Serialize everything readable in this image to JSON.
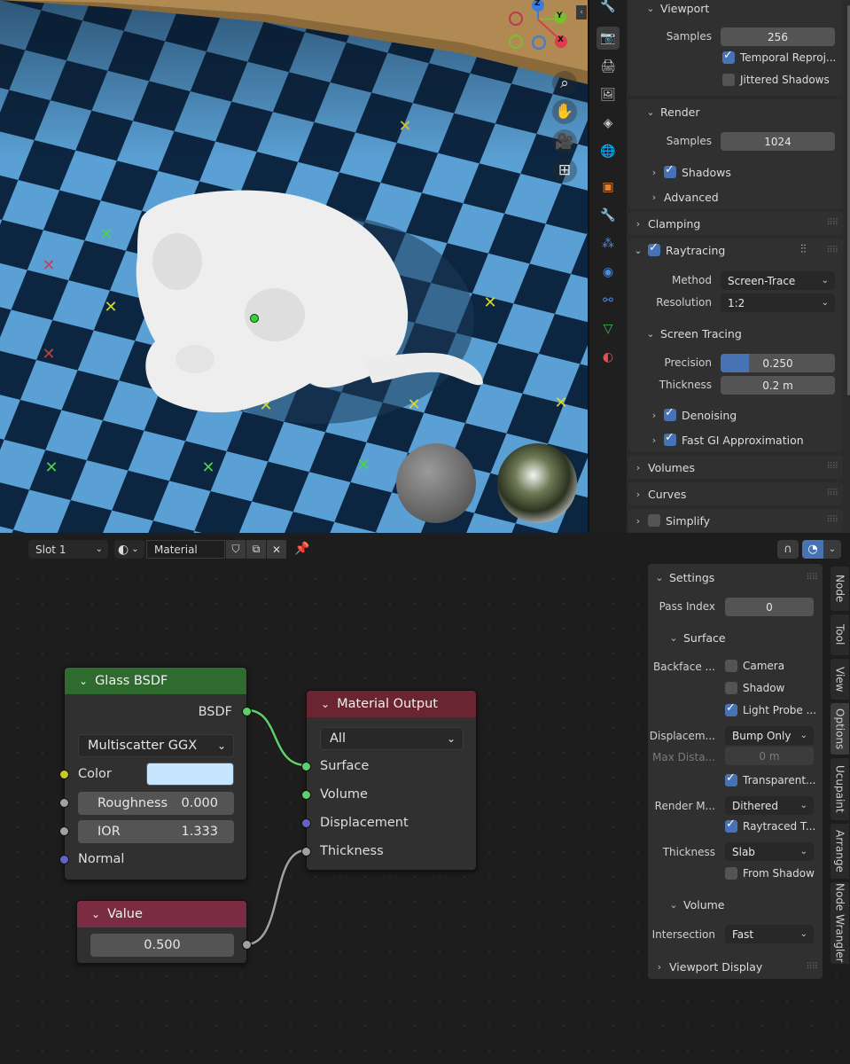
{
  "render_props": {
    "viewport": {
      "label": "Viewport",
      "samples_label": "Samples",
      "samples_value": "256",
      "temporal_reproj": "Temporal Reproj...",
      "temporal_checked": true,
      "jittered_shadows": "Jittered Shadows",
      "jittered_checked": false
    },
    "render": {
      "label": "Render",
      "samples_label": "Samples",
      "samples_value": "1024",
      "shadows": "Shadows",
      "advanced": "Advanced"
    },
    "clamping": "Clamping",
    "raytracing": {
      "label": "Raytracing",
      "method_label": "Method",
      "method_value": "Screen-Trace",
      "resolution_label": "Resolution",
      "resolution_value": "1:2",
      "screen_tracing": "Screen Tracing",
      "precision_label": "Precision",
      "precision_value": "0.250",
      "precision_fraction": 0.25,
      "thickness_label": "Thickness",
      "thickness_value": "0.2 m",
      "denoising": "Denoising",
      "fast_gi": "Fast GI Approximation"
    },
    "volumes": "Volumes",
    "curves": "Curves",
    "simplify": "Simplify"
  },
  "shader_header": {
    "slot": "Slot 1",
    "material_name": "Material"
  },
  "nodes": {
    "glass": {
      "title": "Glass BSDF",
      "output": "BSDF",
      "distribution": "Multiscatter GGX",
      "color_label": "Color",
      "color_value": "#c6e6ff",
      "roughness_label": "Roughness",
      "roughness_value": "0.000",
      "ior_label": "IOR",
      "ior_value": "1.333",
      "normal_label": "Normal"
    },
    "output": {
      "title": "Material Output",
      "target": "All",
      "surface": "Surface",
      "volume": "Volume",
      "displacement": "Displacement",
      "thickness": "Thickness"
    },
    "value": {
      "title": "Value",
      "value": "0.500"
    }
  },
  "npanel": {
    "settings": "Settings",
    "pass_index_label": "Pass Index",
    "pass_index_value": "0",
    "surface": "Surface",
    "backface_label": "Backface ...",
    "camera": "Camera",
    "shadow": "Shadow",
    "light_probe": "Light Probe ...",
    "displacement_label": "Displacem...",
    "displacement_value": "Bump Only",
    "max_dist_label": "Max Dista...",
    "max_dist_value": "0 m",
    "transparent": "Transparent...",
    "render_mode_label": "Render M...",
    "render_mode_value": "Dithered",
    "raytraced_t": "Raytraced T...",
    "thickness_label": "Thickness",
    "thickness_value": "Slab",
    "from_shadow": "From Shadow",
    "volume": "Volume",
    "intersection_label": "Intersection",
    "intersection_value": "Fast",
    "viewport_display": "Viewport Display"
  },
  "side_tabs": [
    "Node",
    "Tool",
    "View",
    "Options",
    "Ucupaint",
    "Arrange",
    "Node Wrangler"
  ],
  "gizmo": {
    "z": "Z",
    "y": "Y",
    "x": "X"
  },
  "colors": {
    "accent": "#4772b3",
    "glass_header": "#2f6b2f",
    "output_header": "#6b2530",
    "value_header": "#7a2c42",
    "socket_shader": "#5fcf6a",
    "socket_color": "#c7c729",
    "socket_float": "#a1a1a1",
    "socket_vector": "#6363c7"
  }
}
